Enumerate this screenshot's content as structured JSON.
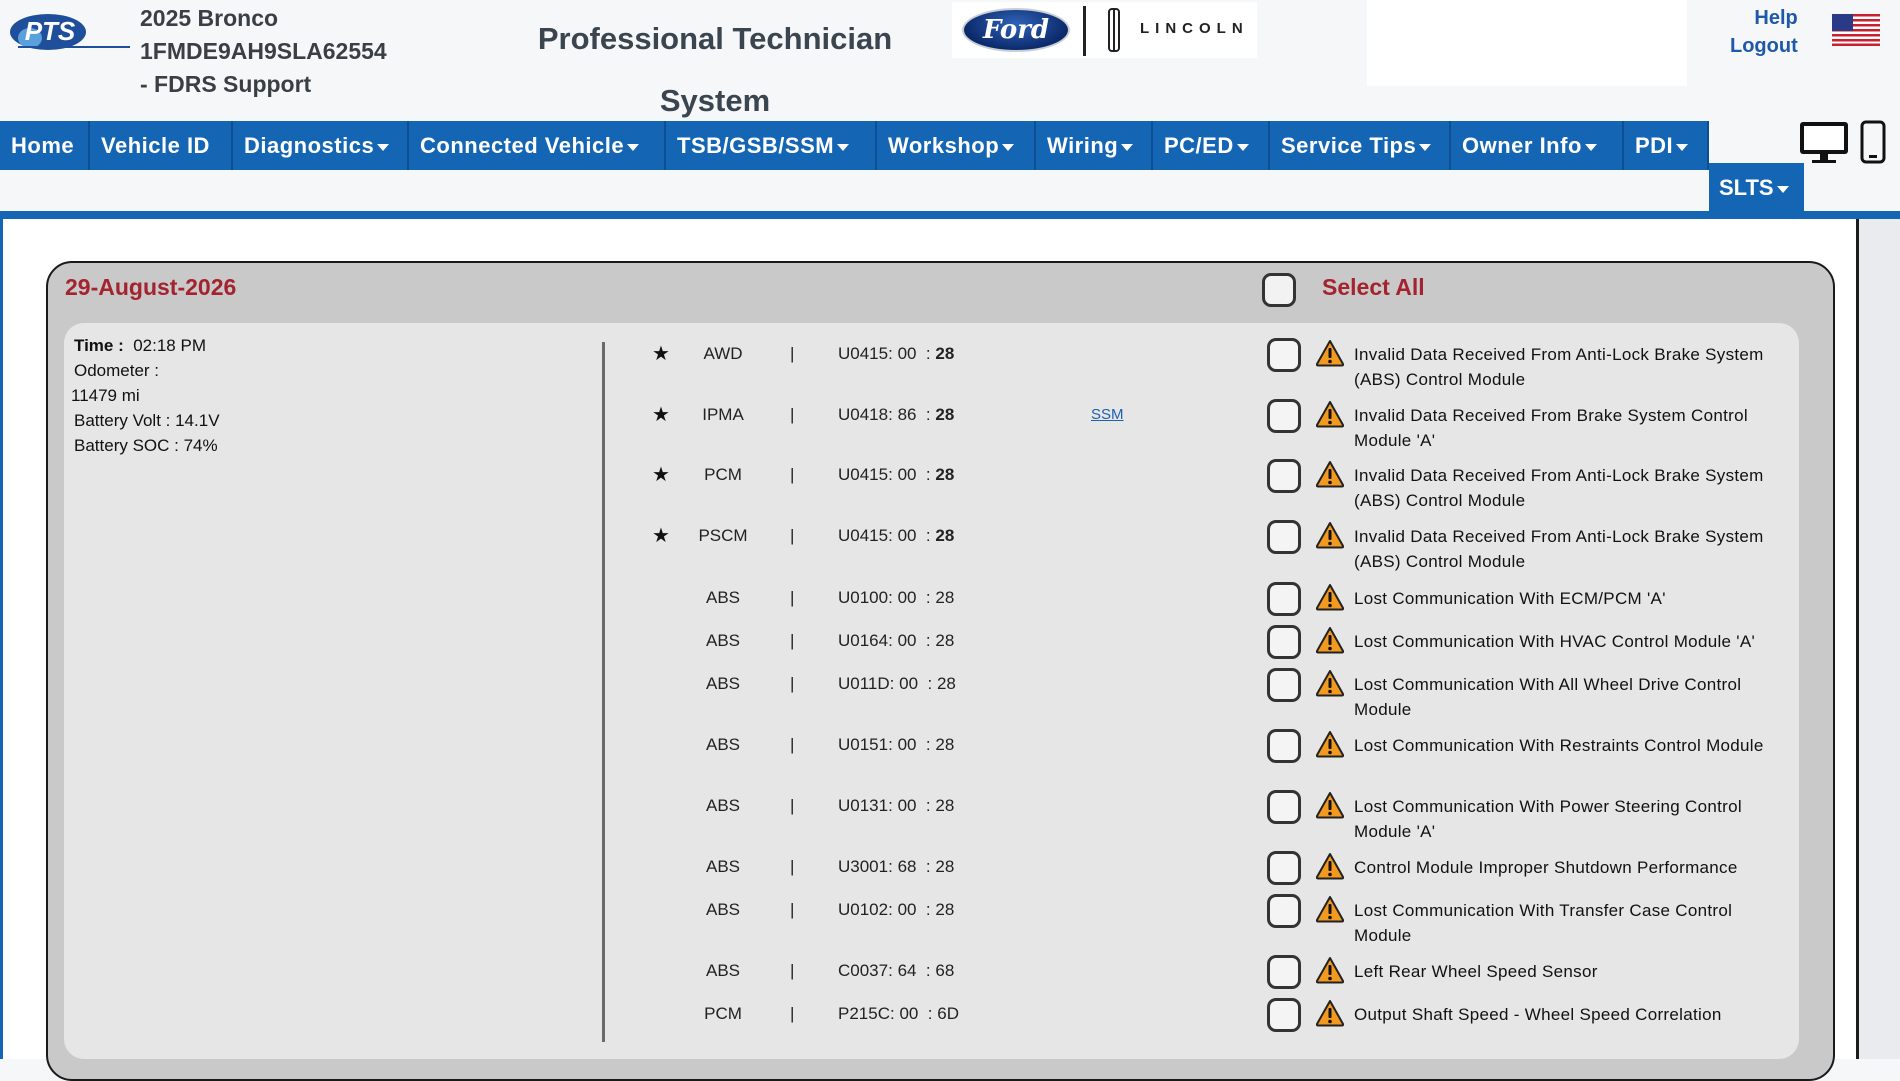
{
  "header": {
    "vehicle_line1": "2025 Bronco",
    "vehicle_line2": "1FMDE9AH9SLA62554",
    "vehicle_line3": "- FDRS Support",
    "title_line1": "Professional Technician",
    "title_line2": "System",
    "logo_text": "PTS",
    "ford_text": "Ford",
    "lincoln_text": "LINCOLN",
    "help": "Help",
    "logout": "Logout"
  },
  "nav": [
    {
      "label": "Home",
      "caret": false
    },
    {
      "label": "Vehicle ID",
      "caret": false
    },
    {
      "label": "Diagnostics",
      "caret": true
    },
    {
      "label": "Connected Vehicle",
      "caret": true
    },
    {
      "label": "TSB/GSB/SSM",
      "caret": true
    },
    {
      "label": "Workshop",
      "caret": true
    },
    {
      "label": "Wiring",
      "caret": true
    },
    {
      "label": "PC/ED",
      "caret": true
    },
    {
      "label": "Service Tips",
      "caret": true
    },
    {
      "label": "Owner Info",
      "caret": true
    },
    {
      "label": "PDI",
      "caret": true
    }
  ],
  "nav_slts": "SLTS",
  "panel": {
    "date": "29-August-2026",
    "select_all": "Select All",
    "time_label": "Time :",
    "time_value": "02:18 PM",
    "odometer_label": "Odometer :",
    "odometer_value": "11479 mi",
    "battery_volt": "Battery Volt : 14.1V",
    "battery_soc": "Battery SOC : 74%"
  },
  "dtcs": [
    {
      "star": true,
      "module": "AWD",
      "code": "U0415",
      "sub": "00",
      "status": "28",
      "ssm": "",
      "desc": "Invalid Data Received From Anti-Lock Brake System (ABS) Control Module"
    },
    {
      "star": true,
      "module": "IPMA",
      "code": "U0418",
      "sub": "86",
      "status": "28",
      "ssm": "SSM",
      "desc": "Invalid Data Received From Brake System Control Module 'A'"
    },
    {
      "star": true,
      "module": "PCM",
      "code": "U0415",
      "sub": "00",
      "status": "28",
      "ssm": "",
      "desc": "Invalid Data Received From Anti-Lock Brake System (ABS) Control Module"
    },
    {
      "star": true,
      "module": "PSCM",
      "code": "U0415",
      "sub": "00",
      "status": "28",
      "ssm": "",
      "desc": "Invalid Data Received From Anti-Lock Brake System (ABS) Control Module"
    },
    {
      "star": false,
      "module": "ABS",
      "code": "U0100",
      "sub": "00",
      "status": "28",
      "ssm": "",
      "desc": "Lost Communication With ECM/PCM 'A'"
    },
    {
      "star": false,
      "module": "ABS",
      "code": "U0164",
      "sub": "00",
      "status": "28",
      "ssm": "",
      "desc": "Lost Communication With HVAC Control Module 'A'"
    },
    {
      "star": false,
      "module": "ABS",
      "code": "U011D",
      "sub": "00",
      "status": "28",
      "ssm": "",
      "desc": "Lost Communication With All Wheel Drive Control Module"
    },
    {
      "star": false,
      "module": "ABS",
      "code": "U0151",
      "sub": "00",
      "status": "28",
      "ssm": "",
      "desc": "Lost Communication With Restraints Control Module"
    },
    {
      "star": false,
      "module": "ABS",
      "code": "U0131",
      "sub": "00",
      "status": "28",
      "ssm": "",
      "desc": "Lost Communication With Power Steering Control Module 'A'"
    },
    {
      "star": false,
      "module": "ABS",
      "code": "U3001",
      "sub": "68",
      "status": "28",
      "ssm": "",
      "desc": "Control Module Improper Shutdown Performance"
    },
    {
      "star": false,
      "module": "ABS",
      "code": "U0102",
      "sub": "00",
      "status": "28",
      "ssm": "",
      "desc": "Lost Communication With Transfer Case Control Module"
    },
    {
      "star": false,
      "module": "ABS",
      "code": "C0037",
      "sub": "64",
      "status": "68",
      "ssm": "",
      "desc": "Left Rear Wheel Speed Sensor"
    },
    {
      "star": false,
      "module": "PCM",
      "code": "P215C",
      "sub": "00",
      "status": "6D",
      "ssm": "",
      "desc": "Output Shaft Speed - Wheel Speed Correlation"
    }
  ],
  "colors": {
    "nav_blue": "#1565b5",
    "accent_red": "#a3232e",
    "warning_orange": "#f29a1f"
  },
  "icons": {
    "warning": "warning-triangle-icon",
    "star": "star-icon",
    "monitor": "desktop-monitor-icon",
    "phone": "mobile-phone-icon",
    "flag": "us-flag-icon"
  }
}
